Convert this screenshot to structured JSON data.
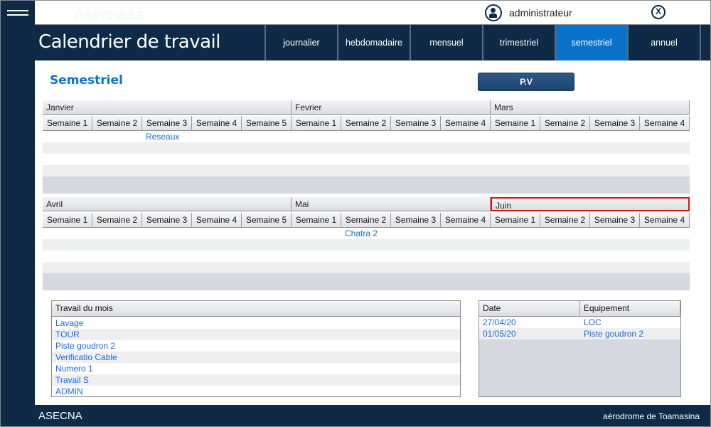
{
  "watermark": "Asecnaaa",
  "user": "administrateur",
  "header": {
    "title": "Calendrier de travail",
    "tabs": [
      "journalier",
      "hebdomadaire",
      "mensuel",
      "trimestriel",
      "semestriel",
      "annuel"
    ],
    "active_tab": "semestriel"
  },
  "section_title": "Semestriel",
  "pv_button": "P.V",
  "grid1": {
    "months": [
      "Janvier",
      "Fevrier",
      "Mars"
    ],
    "weeks": [
      "Semaine 1",
      "Semaine 2",
      "Semaine 3",
      "Semaine 4",
      "Semaine 5",
      "Semaine 1",
      "Semaine 2",
      "Semaine 3",
      "Semaine 4",
      "Semaine 1",
      "Semaine 2",
      "Semaine 3",
      "Semaine 4"
    ],
    "event": "Reseaux"
  },
  "grid2": {
    "months": [
      "Avril",
      "Mai",
      "Juin"
    ],
    "weeks": [
      "Semaine 1",
      "Semaine 2",
      "Semaine 3",
      "Semaine 4",
      "Semaine 5",
      "Semaine 1",
      "Semaine 2",
      "Semaine 3",
      "Semaine 4",
      "Semaine 1",
      "Semaine 2",
      "Semaine 3",
      "Semaine 4"
    ],
    "event": "Chatra 2",
    "selected_month": "Juin"
  },
  "travail": {
    "header": "Travail du mois",
    "items": [
      "Lavage",
      "TOUR",
      "Piste goudron 2",
      "Verificatio Cable",
      "Numero 1",
      "Travail S",
      "ADMIN"
    ]
  },
  "equip": {
    "headers": [
      "Date",
      "Equipement"
    ],
    "rows": [
      [
        "27/04/20",
        "LOC"
      ],
      [
        "01/05/20",
        "Piste goudron 2"
      ]
    ]
  },
  "footer": {
    "left": "ASECNA",
    "right": "aérodrome de Toamasina"
  }
}
